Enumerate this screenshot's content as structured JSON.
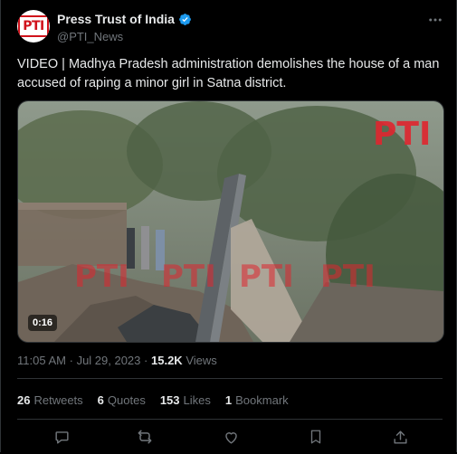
{
  "account": {
    "display_name": "Press Trust of India",
    "handle": "@PTI_News",
    "avatar_logo": "PTI",
    "verified": true
  },
  "tweet": {
    "text": "VIDEO | Madhya Pradesh administration demolishes the house of a man accused of raping a minor girl in Satna district."
  },
  "media": {
    "type": "video",
    "duration": "0:16",
    "watermark_top": "PTI",
    "watermark_row": [
      "PTI",
      "PTI",
      "PTI",
      "PTI"
    ]
  },
  "meta": {
    "time": "11:05 AM",
    "separator": "·",
    "date": "Jul 29, 2023",
    "views_count": "15.2K",
    "views_label": "Views"
  },
  "stats": {
    "retweets": {
      "count": "26",
      "label": "Retweets"
    },
    "quotes": {
      "count": "6",
      "label": "Quotes"
    },
    "likes": {
      "count": "153",
      "label": "Likes"
    },
    "bookmarks": {
      "count": "1",
      "label": "Bookmark"
    }
  },
  "icons": {
    "more": "more-icon",
    "reply": "reply-icon",
    "retweet": "retweet-icon",
    "like": "like-icon",
    "bookmark": "bookmark-icon",
    "share": "share-icon",
    "verified": "verified-badge-icon"
  },
  "colors": {
    "background": "#000000",
    "text": "#e7e9ea",
    "secondary_text": "#71767b",
    "verified_blue": "#1d9bf0",
    "divider": "#2f3336",
    "watermark_red": "#e0262f"
  }
}
